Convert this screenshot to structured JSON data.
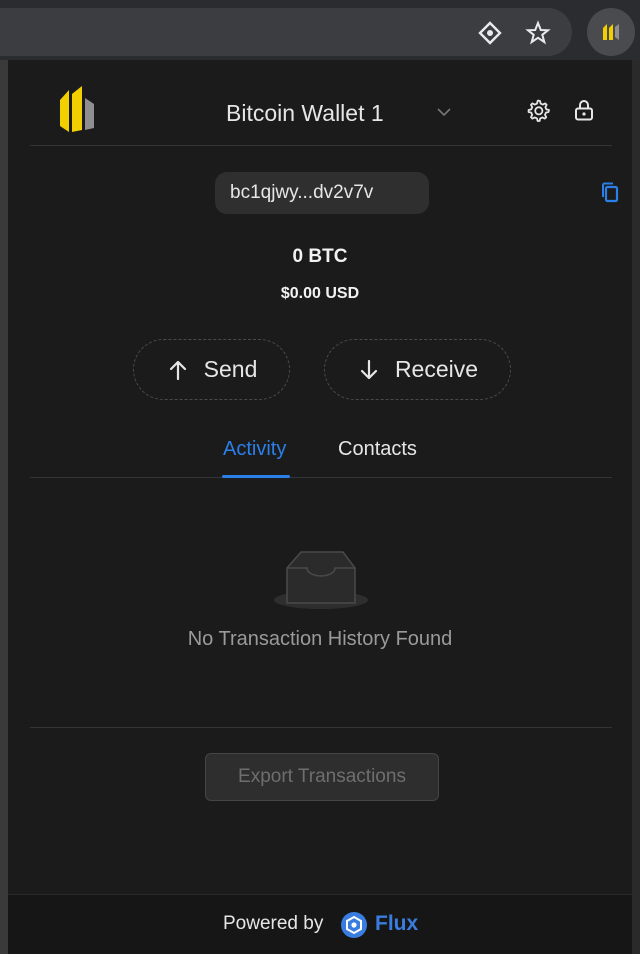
{
  "browser": {
    "toolbar_icons": [
      "diamond-eye-icon",
      "star-icon"
    ],
    "extension_icon": "flux-extension-icon"
  },
  "header": {
    "wallet_name": "Bitcoin Wallet 1",
    "icons": [
      "wallet-logo-icon",
      "chevron-down-icon",
      "gear-icon",
      "lock-icon"
    ]
  },
  "address": {
    "short": "bc1qjwy...dv2v7v",
    "copy_icon": "copy-icon"
  },
  "balance": {
    "btc": "0 BTC",
    "usd": "$0.00 USD"
  },
  "actions": {
    "send_label": "Send",
    "receive_label": "Receive"
  },
  "tabs": [
    {
      "label": "Activity",
      "active": true
    },
    {
      "label": "Contacts",
      "active": false
    }
  ],
  "activity": {
    "empty_message": "No Transaction History Found"
  },
  "export": {
    "label": "Export Transactions"
  },
  "footer": {
    "powered_by": "Powered by",
    "brand": "Flux"
  },
  "colors": {
    "accent": "#2b7fe8",
    "logo_yellow": "#f2d000",
    "background": "#1b1b1b"
  }
}
